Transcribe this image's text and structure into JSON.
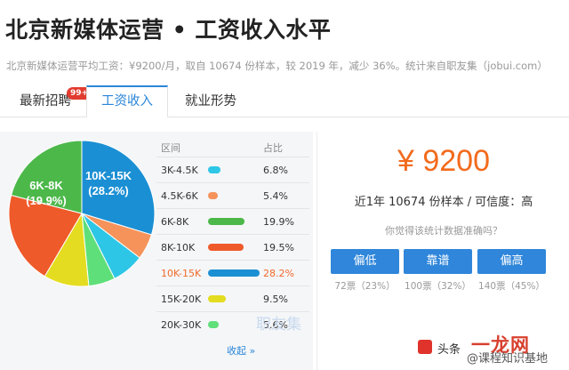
{
  "page": {
    "title": "北京新媒体运营 • 工资收入水平",
    "summary": "北京新媒体运营平均工资：¥9200/月，取自 10674 份样本，较 2019 年，减少 36%。统计来自职友集（jobui.com）"
  },
  "tabs": [
    {
      "label": "最新招聘",
      "badge": "99+"
    },
    {
      "label": "工资收入"
    },
    {
      "label": "就业形势"
    }
  ],
  "distribution": {
    "header_range": "区间",
    "header_pct": "占比",
    "watermark": "职友集",
    "collapse_label": "收起 »",
    "pie_label_1": "10K-15K",
    "pie_label_1_pct": "(28.2%)",
    "pie_label_2": "6K-8K",
    "pie_label_2_pct": "(19.9%)",
    "rows": [
      {
        "range": "3K-4.5K",
        "pct": "6.8%",
        "color": "#2ec6e6",
        "value": 6.8
      },
      {
        "range": "4.5K-6K",
        "pct": "5.4%",
        "color": "#f5935b",
        "value": 5.4
      },
      {
        "range": "6K-8K",
        "pct": "19.9%",
        "color": "#4cb84a",
        "value": 19.9
      },
      {
        "range": "8K-10K",
        "pct": "19.5%",
        "color": "#ef5a2a",
        "value": 19.5
      },
      {
        "range": "10K-15K",
        "pct": "28.2%",
        "color": "#1b8fd3",
        "value": 28.2
      },
      {
        "range": "15K-20K",
        "pct": "9.5%",
        "color": "#e4dc20",
        "value": 9.5
      },
      {
        "range": "20K-30K",
        "pct": "5.6%",
        "color": "#5fdf7a",
        "value": 5.6
      }
    ]
  },
  "salary": {
    "price": "¥ 9200",
    "sample": "近1年 10674 份样本 / 可信度：高",
    "question": "你觉得该统计数据准确吗？",
    "votes": [
      {
        "label": "偏低",
        "count": "72票（23%）"
      },
      {
        "label": "靠谱",
        "count": "100票（32%）"
      },
      {
        "label": "偏高",
        "count": "140票（45%）"
      }
    ]
  },
  "source": {
    "prefix": "头条",
    "brand": "一龙网",
    "site": "@课程知识基地"
  }
}
